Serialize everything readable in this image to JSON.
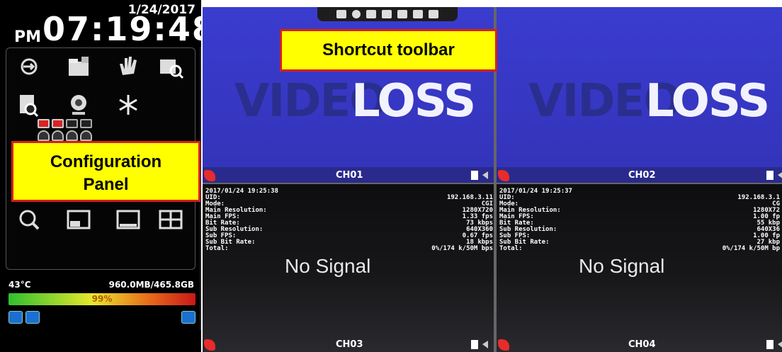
{
  "clock": {
    "date": "1/24/2017",
    "ampm": "PM",
    "time": "07:19:48"
  },
  "status": {
    "temperature": "43°C",
    "disk": "960.0MB/465.8GB",
    "usage_percent_label": "99%",
    "usage_fraction": 0.99
  },
  "callouts": {
    "config": "Configuration\nPanel",
    "toolbar": "Shortcut  toolbar"
  },
  "video_loss": {
    "dim": "VIDEO",
    "bright": "LOSS"
  },
  "no_signal": "No Signal",
  "channels": [
    {
      "label": "CH01",
      "timestamp": "",
      "mode": "video_loss"
    },
    {
      "label": "CH02",
      "timestamp": "",
      "mode": "video_loss"
    },
    {
      "label": "CH03",
      "mode": "no_signal",
      "timestamp": "2017/01/24 19:25:38",
      "info_rows": [
        [
          "UID:",
          "192.168.3.11"
        ],
        [
          "Mode:",
          "CGI"
        ],
        [
          "Main Resolution:",
          "1280X720"
        ],
        [
          "Main FPS:",
          "1.33 fps"
        ],
        [
          "Bit Rate:",
          "73 kbps"
        ],
        [
          "Sub Resolution:",
          "640X360"
        ],
        [
          "Sub FPS:",
          "0.67 fps"
        ],
        [
          "Sub Bit Rate:",
          "18 kbps"
        ],
        [
          "Total:",
          "0%/174 k/50M bps"
        ]
      ]
    },
    {
      "label": "CH04",
      "mode": "no_signal",
      "timestamp": "2017/01/24 19:25:37",
      "info_rows": [
        [
          "UID:",
          "192.168.3.1"
        ],
        [
          "Mode:",
          "CG"
        ],
        [
          "Main Resolution:",
          "1280X72"
        ],
        [
          "Main FPS:",
          "1.00 fp"
        ],
        [
          "Bit Rate:",
          "55 kbp"
        ],
        [
          "Sub Resolution:",
          "640X36"
        ],
        [
          "Sub FPS:",
          "1.00 fp"
        ],
        [
          "Sub Bit Rate:",
          "27 kbp"
        ],
        [
          "Total:",
          "0%/174 k/50M bp"
        ]
      ]
    }
  ],
  "icons": {
    "left_row1": [
      "logout-icon",
      "folder-icon",
      "hand-icon",
      "calendar-search-icon"
    ],
    "left_row2": [
      "document-search-icon",
      "webcam-icon",
      "freeze-icon"
    ],
    "left_row3": [
      "zoom-icon",
      "layout-1-icon",
      "layout-single-icon",
      "layout-4-icon"
    ],
    "toolbar": [
      "lock-icon",
      "info-icon",
      "monitor-icon",
      "camera-icon",
      "layout-icon",
      "list-icon",
      "network-icon"
    ],
    "status": [
      "network-status-icon",
      "usb-icon",
      "user-icon"
    ]
  }
}
